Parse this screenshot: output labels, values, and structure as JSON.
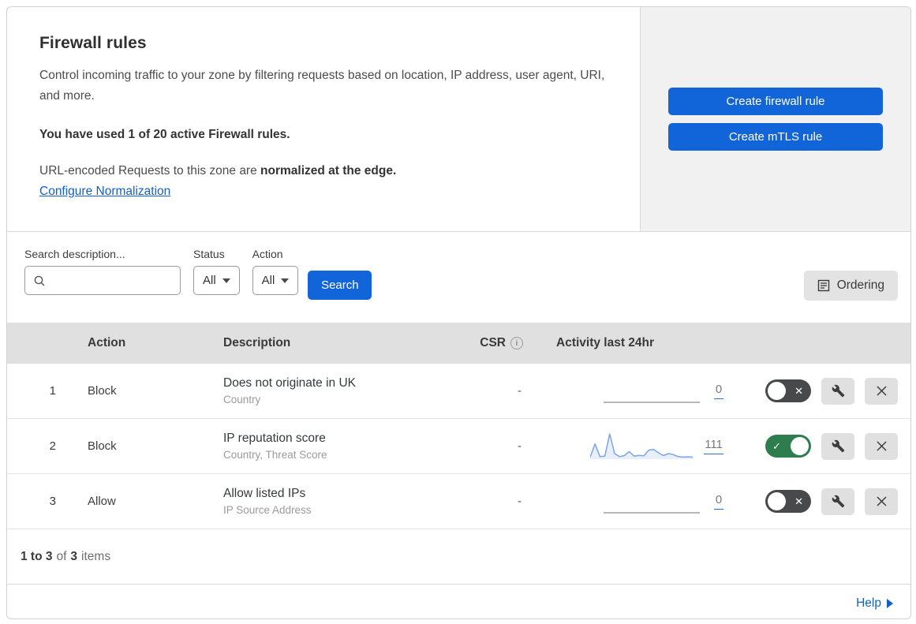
{
  "colors": {
    "primary_blue": "#1264d9",
    "link_blue": "#1160c7",
    "toggle_on_green": "#2e7d4f",
    "toggle_off_gray": "#47494b",
    "table_header_bg": "#e0e0e0",
    "side_panel_bg": "#f1f1f1",
    "sparkline_line": "#7da4e3",
    "sparkline_fill": "rgba(125,164,227,0.18)"
  },
  "header_card": {
    "title": "Firewall rules",
    "description": "Control incoming traffic to your zone by filtering requests based on location, IP address, user agent, URI, and more.",
    "usage": "You have used 1 of 20 active Firewall rules.",
    "normalization_text": "URL-encoded Requests to this zone are",
    "normalization_bold": "normalized at the edge.",
    "normalization_link": "Configure Normalization"
  },
  "actions_panel": {
    "create_firewall_rule": "Create firewall rule",
    "create_mtls_rule": "Create mTLS rule"
  },
  "filters": {
    "search_label": "Search description...",
    "status_label": "Status",
    "status_value": "All",
    "action_label": "Action",
    "action_value": "All",
    "search_button": "Search",
    "ordering_button": "Ordering"
  },
  "table": {
    "headers": {
      "action": "Action",
      "description": "Description",
      "csr": "CSR",
      "activity": "Activity last 24hr"
    },
    "rows": [
      {
        "index": "1",
        "action": "Block",
        "title": "Does not originate in UK",
        "subtitle": "Country",
        "csr": "-",
        "activity_count": "0",
        "enabled": false,
        "sparkline": []
      },
      {
        "index": "2",
        "action": "Block",
        "title": "IP reputation score",
        "subtitle": "Country, Threat Score",
        "csr": "-",
        "activity_count": "111",
        "enabled": true,
        "sparkline": [
          0.08,
          0.6,
          0.1,
          0.12,
          1.0,
          0.22,
          0.1,
          0.14,
          0.3,
          0.12,
          0.15,
          0.13,
          0.36,
          0.38,
          0.25,
          0.14,
          0.22,
          0.18,
          0.1,
          0.08,
          0.09,
          0.08
        ]
      },
      {
        "index": "3",
        "action": "Allow",
        "title": "Allow listed IPs",
        "subtitle": "IP Source Address",
        "csr": "-",
        "activity_count": "0",
        "enabled": false,
        "sparkline": []
      }
    ],
    "footer": {
      "range": "1 to 3",
      "of": "of",
      "total": "3",
      "items": "items"
    }
  },
  "help": {
    "label": "Help"
  }
}
